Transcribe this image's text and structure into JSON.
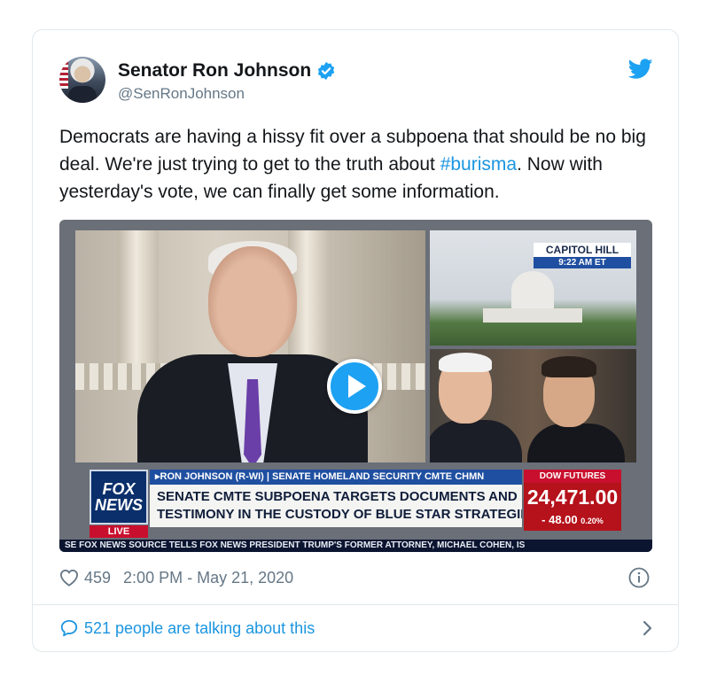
{
  "tweet": {
    "display_name": "Senator Ron Johnson",
    "handle": "@SenRonJohnson",
    "text_before": "Democrats are having a hissy fit over a subpoena that should be no big deal. We're just trying to get to the truth about ",
    "hashtag": "#burisma",
    "text_after": ". Now with yesterday's vote, we can finally get some information.",
    "likes": "459",
    "timestamp": "2:00 PM - May 21, 2020",
    "talking": "521 people are talking about this"
  },
  "video": {
    "location": "CAPITOL HILL",
    "location_time": "9:22 AM ET",
    "network_line1": "FOX",
    "network_line2": "NEWS",
    "live": "LIVE",
    "chyron_top": "▸RON JOHNSON (R-WI) | SENATE HOMELAND SECURITY CMTE CHMN",
    "chyron_line1": "SENATE CMTE SUBPOENA TARGETS DOCUMENTS AND",
    "chyron_line2": "TESTIMONY IN THE CUSTODY OF BLUE STAR STRATEGIES",
    "dow_title": "DOW FUTURES",
    "dow_value": "24,471.00",
    "dow_change": "- 48.00",
    "dow_change_pct": "0.20%",
    "ticker": "SE  FOX NEWS    SOURCE TELLS FOX NEWS PRESIDENT TRUMP'S FORMER ATTORNEY, MICHAEL COHEN, IS"
  },
  "colors": {
    "link_blue": "#1b95e0",
    "twitter_blue": "#1da1f2",
    "muted": "#657786",
    "fox_red": "#c8102e",
    "fox_blue": "#1f4fa0"
  },
  "icons": [
    "verified-icon",
    "twitter-bird-icon",
    "play-icon",
    "heart-icon",
    "info-icon",
    "speech-bubble-icon",
    "chevron-right-icon"
  ]
}
